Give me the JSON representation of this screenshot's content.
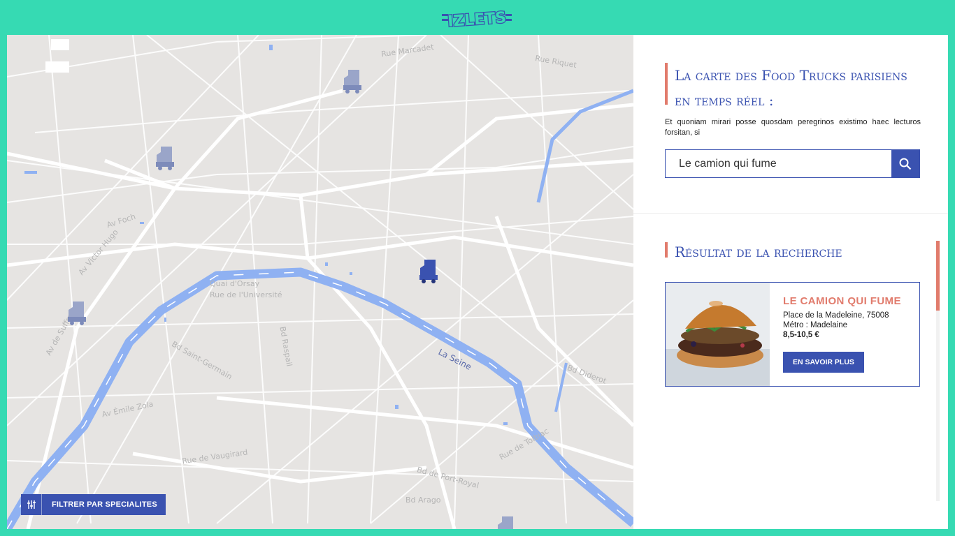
{
  "brand": {
    "logo_text": "IZLETS",
    "teal": "#36dab3",
    "blue": "#3a52b0",
    "coral": "#e17b6c"
  },
  "map": {
    "street_labels": [
      "Rue Marcadet",
      "Rue Riquet",
      "Av Foch",
      "Av Victor Hugo",
      "Quai d'Orsay",
      "Rue de l'Université",
      "Bd Raspail",
      "Bd Saint-Germain",
      "Av de Suffren",
      "Av Émile Zola",
      "Rue de Vaugirard",
      "Bd Arago",
      "Bd Diderot",
      "Bd de Port-Royal",
      "Rue de Tolbiac"
    ],
    "river_label": "La Seine",
    "trucks": [
      {
        "name": "truck-1",
        "active": false
      },
      {
        "name": "truck-2",
        "active": false
      },
      {
        "name": "truck-3",
        "active": true
      },
      {
        "name": "truck-4",
        "active": false
      },
      {
        "name": "truck-5",
        "active": false
      }
    ],
    "filter_button": {
      "label": "FILTRER PAR SPECIALITES",
      "icon": "filter-sliders-icon"
    }
  },
  "panel": {
    "title_line1": "La carte des Food Trucks parisiens",
    "title_line2": "en temps réel :",
    "intro": "Et quoniam mirari posse quosdam peregrinos existimo haec lecturos forsitan, si",
    "search": {
      "value": "Le camion qui fume",
      "placeholder": "",
      "icon": "search-icon"
    },
    "results_title": "Résultat de la recherche",
    "results": [
      {
        "name": "LE CAMION QUI FUME",
        "address": "Place de la Madeleine, 75008",
        "metro": "Métro : Madelaine",
        "price": "8,5-10,5 €",
        "button": "EN SAVOIR PLUS",
        "image": "burger-photo"
      }
    ]
  }
}
